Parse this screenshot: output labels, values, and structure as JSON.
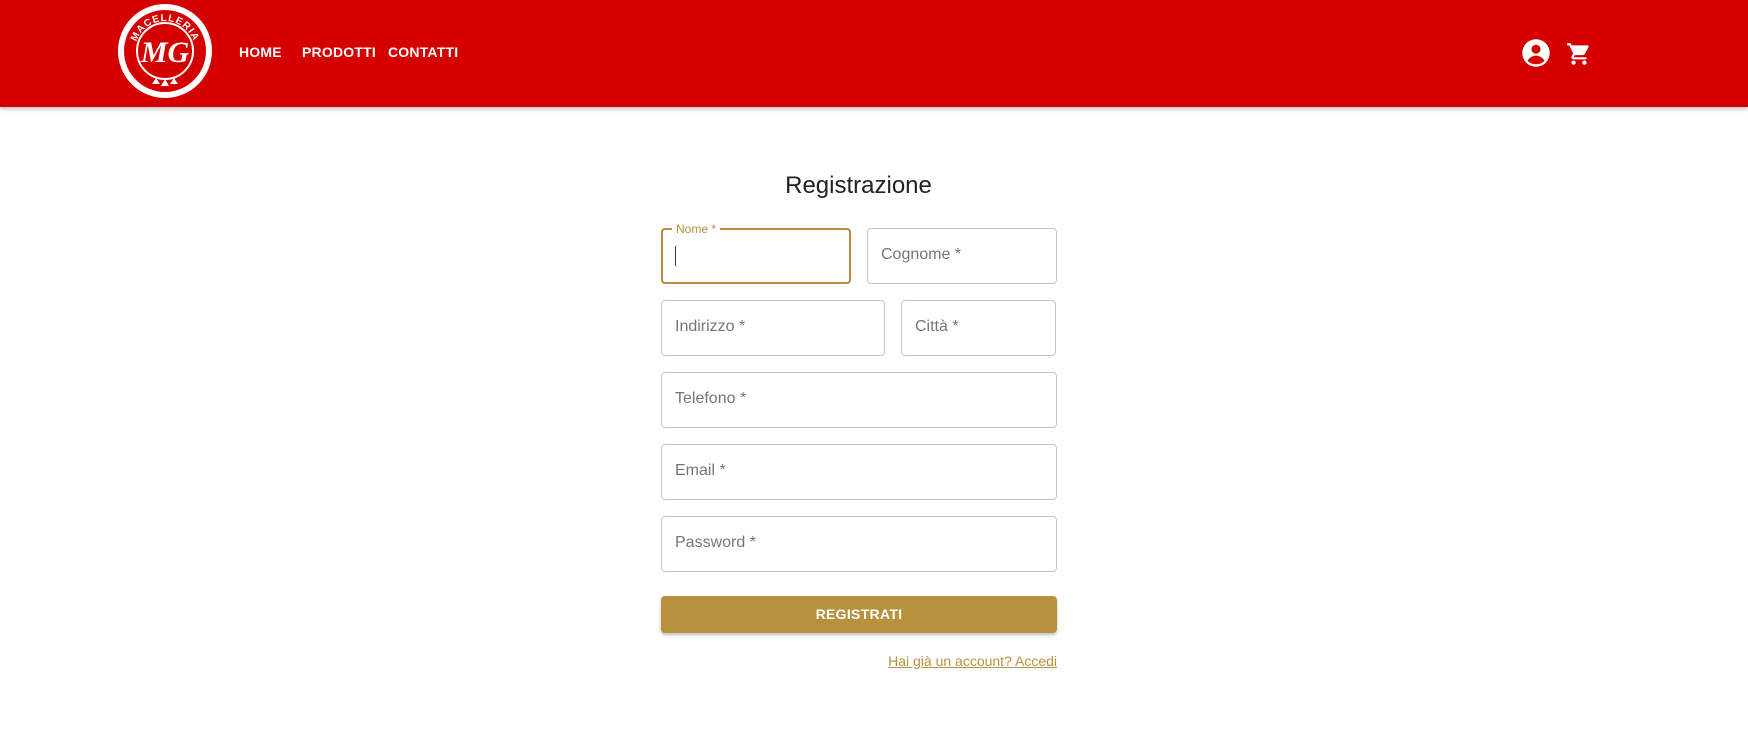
{
  "brand": {
    "logo_text": "MACELLERIA",
    "logo_monogram": "MG",
    "primary_color": "#d40000",
    "accent_color": "#b8913e"
  },
  "nav": {
    "items": [
      {
        "label": "HOME"
      },
      {
        "label": "PRODOTTI"
      },
      {
        "label": "CONTATTI"
      }
    ]
  },
  "header_icons": {
    "account": "account-circle-icon",
    "cart": "shopping-cart-icon"
  },
  "form": {
    "title": "Registrazione",
    "fields": {
      "nome": {
        "label": "Nome *",
        "value": ""
      },
      "cognome": {
        "label": "Cognome *"
      },
      "indirizzo": {
        "label": "Indirizzo *"
      },
      "citta": {
        "label": "Città *"
      },
      "telefono": {
        "label": "Telefono *"
      },
      "email": {
        "label": "Email *"
      },
      "password": {
        "label": "Password *"
      }
    },
    "submit_label": "REGISTRATI",
    "login_link": "Hai già un account? Accedi"
  }
}
